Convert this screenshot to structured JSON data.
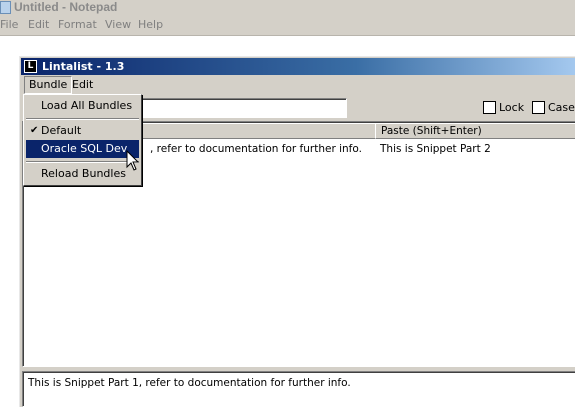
{
  "notepad": {
    "title": "Untitled - Notepad",
    "menus": [
      {
        "label": "File"
      },
      {
        "label": "Edit"
      },
      {
        "label": "Format"
      },
      {
        "label": "View"
      },
      {
        "label": "Help"
      }
    ]
  },
  "lintalist": {
    "title": "Lintalist - 1.3",
    "icon_letter": "L",
    "menus": [
      {
        "label": "Bundle"
      },
      {
        "label": "Edit"
      }
    ],
    "search": {
      "value": ""
    },
    "checkboxes": [
      {
        "label": "Lock",
        "checked": false
      },
      {
        "label": "Case",
        "checked": false
      }
    ],
    "list": {
      "columns": [
        "",
        "Paste (Shift+Enter)"
      ],
      "rows": [
        {
          "col1": "This is Snippet Part 1, refer to documentation for further info.",
          "col1_visible": ", refer to documentation for further info.",
          "col2": "This is Snippet Part 2"
        }
      ]
    },
    "preview": "This is Snippet Part 1, refer to documentation for further info."
  },
  "bundle_menu": {
    "items": [
      {
        "label": "Load All Bundles"
      },
      {
        "label": "Default",
        "checked": true
      },
      {
        "label": "Oracle SQL Dev",
        "highlighted": true
      },
      {
        "label": "Reload Bundles"
      }
    ]
  },
  "colors": {
    "title_active": "#0a246a",
    "menu_highlight": "#0a246a",
    "face": "#d4d0c8"
  }
}
